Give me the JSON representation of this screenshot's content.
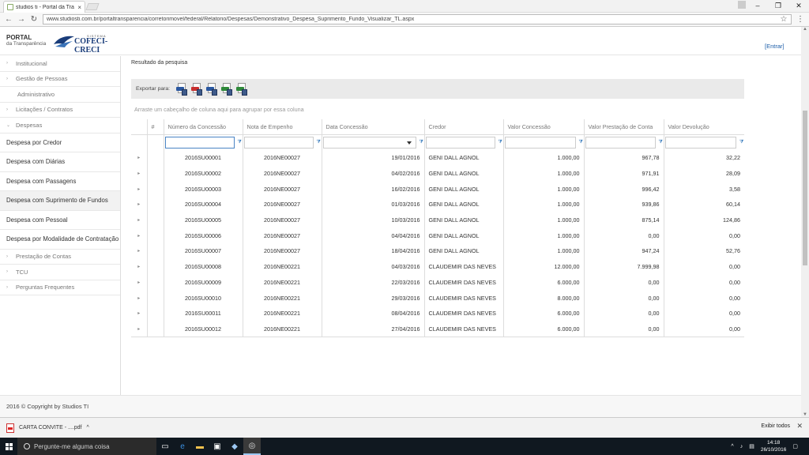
{
  "browser": {
    "tab_title": "studios ti - Portal da Tra",
    "tab_close": "×",
    "window_controls": [
      "–",
      "❐",
      "✕"
    ],
    "url": "www.studiosti.com.br/portaltransparencia/corretorimovel/federal/Relatorio/Despesas/Demonstrativo_Despesa_Suprimento_Fundo_Visualizar_TL.aspx",
    "nav_icons": [
      "←",
      "→",
      "↻"
    ],
    "star_icon": "☆",
    "menu_icon": "⋮"
  },
  "header": {
    "portal_line1": "PORTAL",
    "portal_line2": "da Transparência",
    "logo_system": "SISTEMA",
    "logo_name": "COFECI-CRECI",
    "login_link": "[Entrar]"
  },
  "sidebar": {
    "items": [
      {
        "label": "Institucional",
        "caret": "›"
      },
      {
        "label": "Gestão de Pessoas",
        "caret": "›"
      },
      {
        "label": "Administrativo",
        "caret": ""
      },
      {
        "label": "Licitações / Contratos",
        "caret": "›"
      },
      {
        "label": "Despesas",
        "caret": "⌄"
      }
    ],
    "despesas_items": [
      "Despesa por Credor",
      "Despesa com Diárias",
      "Despesa com Passagens",
      "Despesa com Suprimento de Fundos",
      "Despesa com Pessoal",
      "Despesa por Modalidade de Contratação"
    ],
    "bottom_items": [
      {
        "label": "Prestação de Contas",
        "caret": "›"
      },
      {
        "label": "TCU",
        "caret": "›"
      },
      {
        "label": "Perguntas Frequentes",
        "caret": "›"
      }
    ]
  },
  "content": {
    "result_title": "Resultado da pesquisa",
    "export_label": "Exportar para:",
    "export_icons": [
      {
        "name": "export-pdf-icon",
        "color": "#2a57a0"
      },
      {
        "name": "export-pdf2-icon",
        "color": "#c83030"
      },
      {
        "name": "export-rtf-icon",
        "color": "#2a57a0"
      },
      {
        "name": "export-xls-icon",
        "color": "#2f8a3a"
      },
      {
        "name": "export-csv-icon",
        "color": "#2f8a3a"
      }
    ],
    "group_hint": "Arraste um cabeçalho de coluna aqui para agrupar por essa coluna"
  },
  "grid": {
    "columns": [
      "#",
      "Número da Concessão",
      "Nota de Empenho",
      "Data Concessão",
      "Credor",
      "Valor Concessão",
      "Valor Prestação de Conta",
      "Valor Devolução"
    ],
    "expand_glyph": "▸",
    "rows": [
      [
        "2016SU00001",
        "2016NE00027",
        "19/01/2016",
        "GENI DALL AGNOL",
        "1.000,00",
        "967,78",
        "32,22"
      ],
      [
        "2016SU00002",
        "2016NE00027",
        "04/02/2016",
        "GENI DALL AGNOL",
        "1.000,00",
        "971,91",
        "28,09"
      ],
      [
        "2016SU00003",
        "2016NE00027",
        "16/02/2016",
        "GENI DALL AGNOL",
        "1.000,00",
        "996,42",
        "3,58"
      ],
      [
        "2016SU00004",
        "2016NE00027",
        "01/03/2016",
        "GENI DALL AGNOL",
        "1.000,00",
        "939,86",
        "60,14"
      ],
      [
        "2016SU00005",
        "2016NE00027",
        "10/03/2016",
        "GENI DALL AGNOL",
        "1.000,00",
        "875,14",
        "124,86"
      ],
      [
        "2016SU00006",
        "2016NE00027",
        "04/04/2016",
        "GENI DALL AGNOL",
        "1.000,00",
        "0,00",
        "0,00"
      ],
      [
        "2016SU00007",
        "2016NE00027",
        "18/04/2016",
        "GENI DALL AGNOL",
        "1.000,00",
        "947,24",
        "52,76"
      ],
      [
        "2016SU00008",
        "2016NE00221",
        "04/03/2016",
        "CLAUDEMIR DAS NEVES",
        "12.000,00",
        "7.999,98",
        "0,00"
      ],
      [
        "2016SU00009",
        "2016NE00221",
        "22/03/2016",
        "CLAUDEMIR DAS NEVES",
        "6.000,00",
        "0,00",
        "0,00"
      ],
      [
        "2016SU00010",
        "2016NE00221",
        "29/03/2016",
        "CLAUDEMIR DAS NEVES",
        "8.000,00",
        "0,00",
        "0,00"
      ],
      [
        "2016SU00011",
        "2016NE00221",
        "08/04/2016",
        "CLAUDEMIR DAS NEVES",
        "6.000,00",
        "0,00",
        "0,00"
      ],
      [
        "2016SU00012",
        "2016NE00221",
        "27/04/2016",
        "CLAUDEMIR DAS NEVES",
        "6.000,00",
        "0,00",
        "0,00"
      ]
    ]
  },
  "footer": {
    "copyright": "2016 © Copyright by Studios TI"
  },
  "downloads": {
    "file": "CARTA CONVITE - ....pdf",
    "chevron": "^",
    "show_all": "Exibir todos",
    "close": "✕"
  },
  "taskbar": {
    "search_placeholder": "Pergunte-me alguma coisa",
    "time": "14:18",
    "date": "26/10/2016"
  }
}
